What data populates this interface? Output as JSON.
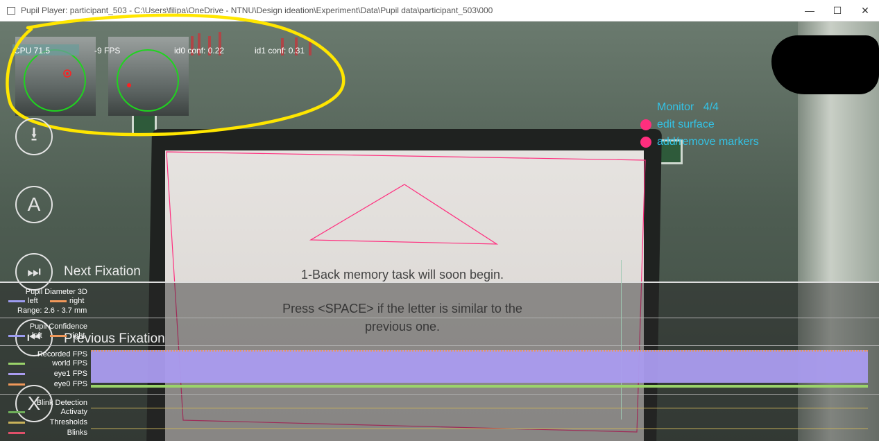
{
  "window": {
    "title": "Pupil Player: participant_503 - C:\\Users\\filipa\\OneDrive - NTNU\\Design ideation\\Experiment\\Data\\Pupil data\\participant_503\\000",
    "minimize": "—",
    "maximize": "☐",
    "close": "✕"
  },
  "hud": {
    "cpu": "CPU 71.5",
    "fps": "-9 FPS",
    "id0_conf": "id0 conf: 0.22",
    "id1_conf": "id1 conf: 0.31"
  },
  "screen_text": {
    "line1": "1-Back memory task will soon begin.",
    "line2": "Press <SPACE> if the letter is similar to the",
    "line3": "previous one."
  },
  "side_buttons": {
    "download_glyph": "⭳",
    "annotation_glyph": "A",
    "next_glyph": "⏭",
    "next_label": "Next Fixation",
    "prev_glyph": "⏮",
    "prev_label": "Previous Fixation",
    "blink_glyph": "X"
  },
  "surface_menu": {
    "name": "Monitor",
    "count": "4/4",
    "edit": "edit surface",
    "add_remove": "add/remove markers",
    "dot_color": "#ff2e7e",
    "text_color": "#33c3e6"
  },
  "timeline": {
    "pupil_diameter": {
      "title": "Pupil Diameter 3D",
      "left": "left",
      "right": "right",
      "range": "Range: 2.6 - 3.7 mm"
    },
    "pupil_confidence": {
      "title": "Pupil Confidence",
      "left": "left",
      "right": "right"
    },
    "fps": {
      "title": "Recorded FPS",
      "world": "world FPS",
      "eye1": "eye1 FPS",
      "eye0": "eye0 FPS"
    },
    "blink": {
      "title": "Blink Detection",
      "activity": "Activaty",
      "thresholds": "Thresholds",
      "blinks": "Blinks"
    },
    "colors": {
      "left": "#9c9cf0",
      "right": "#f0985a",
      "world": "#9ad36a",
      "eye1": "#aa9cf0",
      "eye0": "#f0985a",
      "activity": "#6fae5a",
      "thresholds": "#c9b25a",
      "blinks": "#e0506a"
    }
  },
  "annotation_color": "#ffe600"
}
